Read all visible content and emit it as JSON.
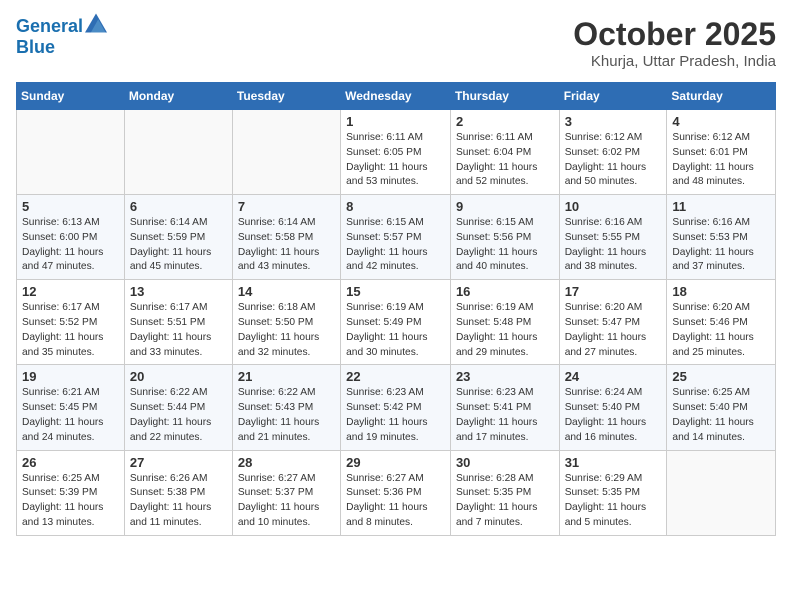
{
  "header": {
    "logo_line1": "General",
    "logo_line2": "Blue",
    "month": "October 2025",
    "location": "Khurja, Uttar Pradesh, India"
  },
  "weekdays": [
    "Sunday",
    "Monday",
    "Tuesday",
    "Wednesday",
    "Thursday",
    "Friday",
    "Saturday"
  ],
  "weeks": [
    [
      {
        "day": "",
        "sunrise": "",
        "sunset": "",
        "daylight": ""
      },
      {
        "day": "",
        "sunrise": "",
        "sunset": "",
        "daylight": ""
      },
      {
        "day": "",
        "sunrise": "",
        "sunset": "",
        "daylight": ""
      },
      {
        "day": "1",
        "sunrise": "Sunrise: 6:11 AM",
        "sunset": "Sunset: 6:05 PM",
        "daylight": "Daylight: 11 hours and 53 minutes."
      },
      {
        "day": "2",
        "sunrise": "Sunrise: 6:11 AM",
        "sunset": "Sunset: 6:04 PM",
        "daylight": "Daylight: 11 hours and 52 minutes."
      },
      {
        "day": "3",
        "sunrise": "Sunrise: 6:12 AM",
        "sunset": "Sunset: 6:02 PM",
        "daylight": "Daylight: 11 hours and 50 minutes."
      },
      {
        "day": "4",
        "sunrise": "Sunrise: 6:12 AM",
        "sunset": "Sunset: 6:01 PM",
        "daylight": "Daylight: 11 hours and 48 minutes."
      }
    ],
    [
      {
        "day": "5",
        "sunrise": "Sunrise: 6:13 AM",
        "sunset": "Sunset: 6:00 PM",
        "daylight": "Daylight: 11 hours and 47 minutes."
      },
      {
        "day": "6",
        "sunrise": "Sunrise: 6:14 AM",
        "sunset": "Sunset: 5:59 PM",
        "daylight": "Daylight: 11 hours and 45 minutes."
      },
      {
        "day": "7",
        "sunrise": "Sunrise: 6:14 AM",
        "sunset": "Sunset: 5:58 PM",
        "daylight": "Daylight: 11 hours and 43 minutes."
      },
      {
        "day": "8",
        "sunrise": "Sunrise: 6:15 AM",
        "sunset": "Sunset: 5:57 PM",
        "daylight": "Daylight: 11 hours and 42 minutes."
      },
      {
        "day": "9",
        "sunrise": "Sunrise: 6:15 AM",
        "sunset": "Sunset: 5:56 PM",
        "daylight": "Daylight: 11 hours and 40 minutes."
      },
      {
        "day": "10",
        "sunrise": "Sunrise: 6:16 AM",
        "sunset": "Sunset: 5:55 PM",
        "daylight": "Daylight: 11 hours and 38 minutes."
      },
      {
        "day": "11",
        "sunrise": "Sunrise: 6:16 AM",
        "sunset": "Sunset: 5:53 PM",
        "daylight": "Daylight: 11 hours and 37 minutes."
      }
    ],
    [
      {
        "day": "12",
        "sunrise": "Sunrise: 6:17 AM",
        "sunset": "Sunset: 5:52 PM",
        "daylight": "Daylight: 11 hours and 35 minutes."
      },
      {
        "day": "13",
        "sunrise": "Sunrise: 6:17 AM",
        "sunset": "Sunset: 5:51 PM",
        "daylight": "Daylight: 11 hours and 33 minutes."
      },
      {
        "day": "14",
        "sunrise": "Sunrise: 6:18 AM",
        "sunset": "Sunset: 5:50 PM",
        "daylight": "Daylight: 11 hours and 32 minutes."
      },
      {
        "day": "15",
        "sunrise": "Sunrise: 6:19 AM",
        "sunset": "Sunset: 5:49 PM",
        "daylight": "Daylight: 11 hours and 30 minutes."
      },
      {
        "day": "16",
        "sunrise": "Sunrise: 6:19 AM",
        "sunset": "Sunset: 5:48 PM",
        "daylight": "Daylight: 11 hours and 29 minutes."
      },
      {
        "day": "17",
        "sunrise": "Sunrise: 6:20 AM",
        "sunset": "Sunset: 5:47 PM",
        "daylight": "Daylight: 11 hours and 27 minutes."
      },
      {
        "day": "18",
        "sunrise": "Sunrise: 6:20 AM",
        "sunset": "Sunset: 5:46 PM",
        "daylight": "Daylight: 11 hours and 25 minutes."
      }
    ],
    [
      {
        "day": "19",
        "sunrise": "Sunrise: 6:21 AM",
        "sunset": "Sunset: 5:45 PM",
        "daylight": "Daylight: 11 hours and 24 minutes."
      },
      {
        "day": "20",
        "sunrise": "Sunrise: 6:22 AM",
        "sunset": "Sunset: 5:44 PM",
        "daylight": "Daylight: 11 hours and 22 minutes."
      },
      {
        "day": "21",
        "sunrise": "Sunrise: 6:22 AM",
        "sunset": "Sunset: 5:43 PM",
        "daylight": "Daylight: 11 hours and 21 minutes."
      },
      {
        "day": "22",
        "sunrise": "Sunrise: 6:23 AM",
        "sunset": "Sunset: 5:42 PM",
        "daylight": "Daylight: 11 hours and 19 minutes."
      },
      {
        "day": "23",
        "sunrise": "Sunrise: 6:23 AM",
        "sunset": "Sunset: 5:41 PM",
        "daylight": "Daylight: 11 hours and 17 minutes."
      },
      {
        "day": "24",
        "sunrise": "Sunrise: 6:24 AM",
        "sunset": "Sunset: 5:40 PM",
        "daylight": "Daylight: 11 hours and 16 minutes."
      },
      {
        "day": "25",
        "sunrise": "Sunrise: 6:25 AM",
        "sunset": "Sunset: 5:40 PM",
        "daylight": "Daylight: 11 hours and 14 minutes."
      }
    ],
    [
      {
        "day": "26",
        "sunrise": "Sunrise: 6:25 AM",
        "sunset": "Sunset: 5:39 PM",
        "daylight": "Daylight: 11 hours and 13 minutes."
      },
      {
        "day": "27",
        "sunrise": "Sunrise: 6:26 AM",
        "sunset": "Sunset: 5:38 PM",
        "daylight": "Daylight: 11 hours and 11 minutes."
      },
      {
        "day": "28",
        "sunrise": "Sunrise: 6:27 AM",
        "sunset": "Sunset: 5:37 PM",
        "daylight": "Daylight: 11 hours and 10 minutes."
      },
      {
        "day": "29",
        "sunrise": "Sunrise: 6:27 AM",
        "sunset": "Sunset: 5:36 PM",
        "daylight": "Daylight: 11 hours and 8 minutes."
      },
      {
        "day": "30",
        "sunrise": "Sunrise: 6:28 AM",
        "sunset": "Sunset: 5:35 PM",
        "daylight": "Daylight: 11 hours and 7 minutes."
      },
      {
        "day": "31",
        "sunrise": "Sunrise: 6:29 AM",
        "sunset": "Sunset: 5:35 PM",
        "daylight": "Daylight: 11 hours and 5 minutes."
      },
      {
        "day": "",
        "sunrise": "",
        "sunset": "",
        "daylight": ""
      }
    ]
  ]
}
